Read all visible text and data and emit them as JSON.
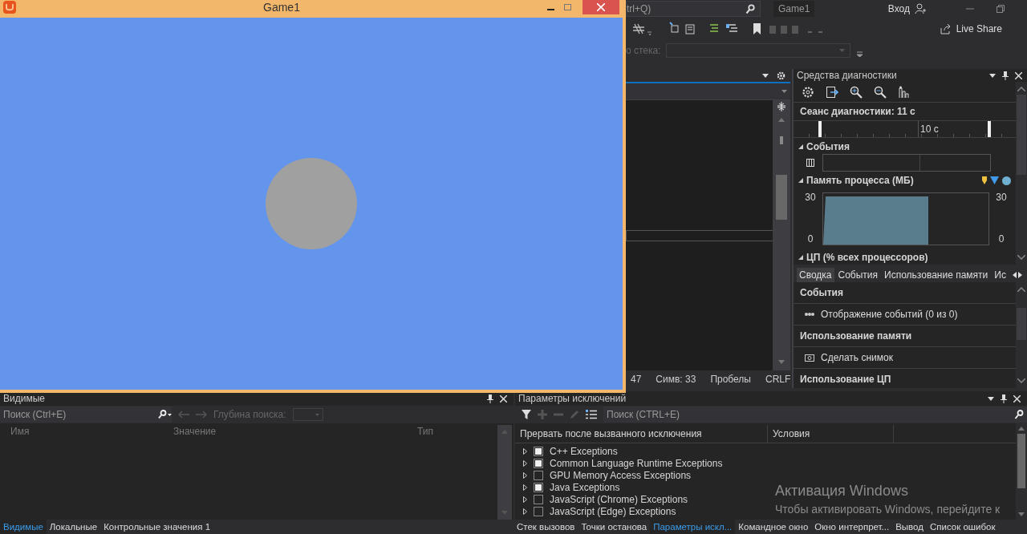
{
  "game_window": {
    "title": "Game1"
  },
  "ide": {
    "quick_launch": {
      "value": "trl+Q)"
    },
    "solution_tab": "Game1",
    "sign_in": "Вход",
    "live_share": "Live Share",
    "stack_label": "о стека:"
  },
  "editor_status": [
    "47",
    "Симв: 33",
    "Пробелы",
    "CRLF"
  ],
  "diagnostics": {
    "title": "Средства диагностики",
    "session": "Сеанс диагностики: 11 с",
    "timeline_label": "10 с",
    "events_section": {
      "title": "События",
      "expanded": true
    },
    "memory_section": {
      "title": "Память процесса (МБ)",
      "expanded": true,
      "left_ticks": [
        "30",
        "0"
      ],
      "right_ticks": [
        "30",
        "0"
      ]
    },
    "cpu_section": {
      "title": "ЦП (% всех процессоров)",
      "expanded": true
    },
    "tabs": [
      {
        "label": "Сводка",
        "selected": true
      },
      {
        "label": "События",
        "selected": false
      },
      {
        "label": "Использование памяти",
        "selected": false
      },
      {
        "label": "Ис",
        "selected": false
      }
    ],
    "summary": [
      {
        "kind": "header",
        "text": "События"
      },
      {
        "kind": "action",
        "text": "Отображение событий (0 из 0)"
      },
      {
        "kind": "header",
        "text": "Использование памяти"
      },
      {
        "kind": "action",
        "text": "Сделать снимок"
      },
      {
        "kind": "header",
        "text": "Использование ЦП"
      }
    ]
  },
  "watch": {
    "title": "Видимые",
    "search_placeholder": "Поиск (Ctrl+E)",
    "depth_label": "Глубина поиска:",
    "columns": [
      "Имя",
      "Значение",
      "Тип"
    ]
  },
  "exceptions": {
    "title": "Параметры исключений",
    "search_placeholder": "Поиск (CTRL+E)",
    "columns": [
      "Прервать после вызванного исключения",
      "Условия"
    ],
    "rows": [
      {
        "label": "C++ Exceptions",
        "checked": true
      },
      {
        "label": "Common Language Runtime Exceptions",
        "checked": true
      },
      {
        "label": "GPU Memory Access Exceptions",
        "checked": false
      },
      {
        "label": "Java Exceptions",
        "checked": true
      },
      {
        "label": "JavaScript (Chrome) Exceptions",
        "checked": false
      },
      {
        "label": "JavaScript (Edge) Exceptions",
        "checked": false
      }
    ]
  },
  "left_tabs": [
    {
      "label": "Видимые",
      "selected": true
    },
    {
      "label": "Локальные",
      "selected": false
    },
    {
      "label": "Контрольные значения 1",
      "selected": false
    }
  ],
  "right_tabs": [
    {
      "label": "Стек вызовов",
      "selected": false
    },
    {
      "label": "Точки останова",
      "selected": false
    },
    {
      "label": "Параметры искл...",
      "selected": true
    },
    {
      "label": "Командное окно",
      "selected": false
    },
    {
      "label": "Окно интерпрет...",
      "selected": false
    },
    {
      "label": "Вывод",
      "selected": false
    },
    {
      "label": "Список ошибок",
      "selected": false
    }
  ],
  "activation": {
    "title": "Активация Windows",
    "text": "Чтобы активировать Windows, перейдите к"
  }
}
